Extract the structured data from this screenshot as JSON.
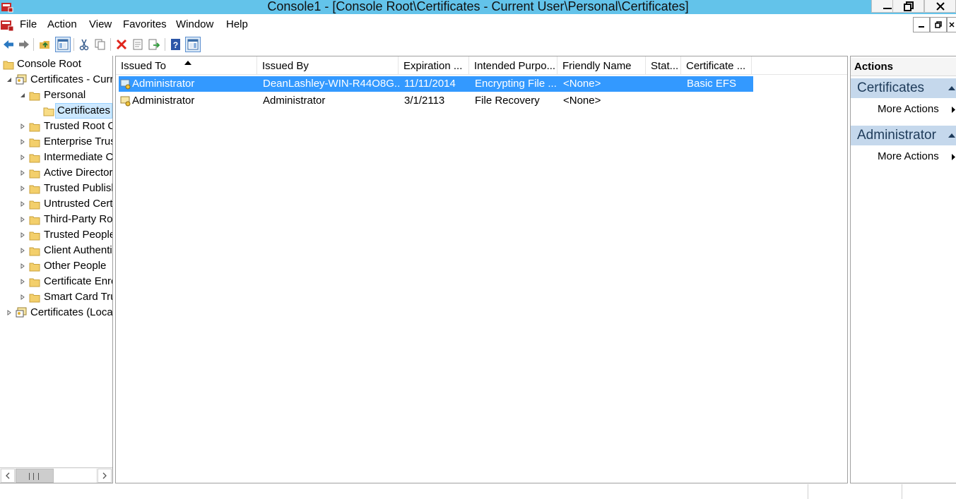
{
  "window": {
    "title": "Console1 - [Console Root\\Certificates - Current User\\Personal\\Certificates]"
  },
  "menu": [
    "File",
    "Action",
    "View",
    "Favorites",
    "Window",
    "Help"
  ],
  "tree": {
    "root": "Console Root",
    "current_user": "Certificates - Current User",
    "personal": "Personal",
    "certificates": "Certificates",
    "stores": [
      "Trusted Root Certification Authorities",
      "Enterprise Trust",
      "Intermediate Certification Authorities",
      "Active Directory User Object",
      "Trusted Publishers",
      "Untrusted Certificates",
      "Third-Party Root Certification Authorities",
      "Trusted People",
      "Client Authentication Issuers",
      "Other People",
      "Certificate Enrollment Requests",
      "Smart Card Trusted Roots"
    ],
    "local_computer": "Certificates (Local Computer)"
  },
  "list": {
    "columns": [
      "Issued To",
      "Issued By",
      "Expiration ...",
      "Intended Purpo...",
      "Friendly Name",
      "Stat...",
      "Certificate ..."
    ],
    "rows": [
      {
        "issued_to": "Administrator",
        "issued_by": "DeanLashley-WIN-R44O8G...",
        "expiration": "11/11/2014",
        "purpose": "Encrypting File ...",
        "friendly": "<None>",
        "status": "",
        "template": "Basic EFS",
        "selected": true
      },
      {
        "issued_to": "Administrator",
        "issued_by": "Administrator",
        "expiration": "3/1/2113",
        "purpose": "File Recovery",
        "friendly": "<None>",
        "status": "",
        "template": "",
        "selected": false
      }
    ]
  },
  "actions": {
    "title": "Actions",
    "sections": [
      {
        "title": "Certificates",
        "item": "More Actions"
      },
      {
        "title": "Administrator",
        "item": "More Actions"
      }
    ]
  },
  "colors": {
    "titlebar": "#63c3ea",
    "selection": "#3399ff",
    "action_header": "#c5d8ec"
  }
}
